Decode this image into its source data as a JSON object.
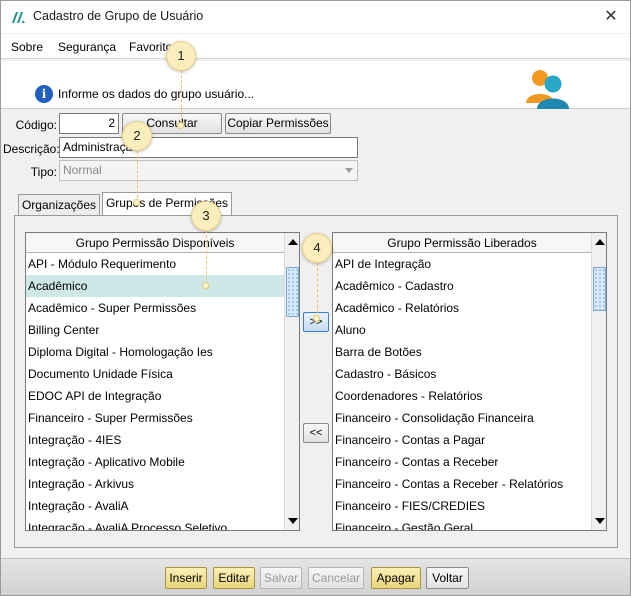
{
  "window": {
    "title": "Cadastro de Grupo de Usuário",
    "close_glyph": "✕"
  },
  "menu": {
    "items": [
      {
        "label": "Sobre"
      },
      {
        "label": "Segurança"
      },
      {
        "label": "Favoritos"
      }
    ]
  },
  "info": {
    "icon": "info-icon",
    "text": "Informe os dados do grupo usuário..."
  },
  "form": {
    "codigo_label": "Código:",
    "codigo_value": "2",
    "consultar_label": "Consultar",
    "copiar_label": "Copiar Permissões",
    "descricao_label": "Descrição:",
    "descricao_value": "Administração",
    "tipo_label": "Tipo:",
    "tipo_value": "Normal"
  },
  "tabs": [
    {
      "label": "Organizações",
      "active": false
    },
    {
      "label": "Grupos de Permissões",
      "active": true
    }
  ],
  "available": {
    "header": "Grupo Permissão Disponíveis",
    "items": [
      "API - Módulo Requerimento",
      "Acadêmico",
      "Acadêmico - Super Permissões",
      "Billing Center",
      "Diploma Digital - Homologação Ies",
      "Documento Unidade Física",
      "EDOC API de Integração",
      "Financeiro - Super Permissões",
      "Integração - 4IES",
      "Integração - Aplicativo Mobile",
      "Integração - Arkivus",
      "Integração - AvaliA",
      "Integração - AvaliA Processo Seletivo"
    ],
    "selected_index": 1
  },
  "released": {
    "header": "Grupo Permissão Liberados",
    "items": [
      "API de Integração",
      "Acadêmico - Cadastro",
      "Acadêmico - Relatórios",
      "Aluno",
      "Barra de Botões",
      "Cadastro - Básicos",
      "Coordenadores - Relatórios",
      "Financeiro - Consolidação Financeira",
      "Financeiro - Contas a Pagar",
      "Financeiro - Contas a Receber",
      "Financeiro - Contas a Receber - Relatórios",
      "Financeiro - FIES/CREDIES",
      "Financeiro - Gestão Geral"
    ]
  },
  "move": {
    "add_label": ">>",
    "remove_label": "<<"
  },
  "actions": [
    {
      "label": "Inserir",
      "state": "primary"
    },
    {
      "label": "Editar",
      "state": "primary"
    },
    {
      "label": "Salvar",
      "state": "disabled"
    },
    {
      "label": "Cancelar",
      "state": "disabled"
    },
    {
      "label": "Apagar",
      "state": "primary"
    },
    {
      "label": "Voltar",
      "state": "normal"
    }
  ],
  "callouts": [
    "1",
    "2",
    "3",
    "4"
  ],
  "colors": {
    "selection": "#cde8e6",
    "primary_button": "#e9d57a",
    "callout": "#fbeebd"
  }
}
